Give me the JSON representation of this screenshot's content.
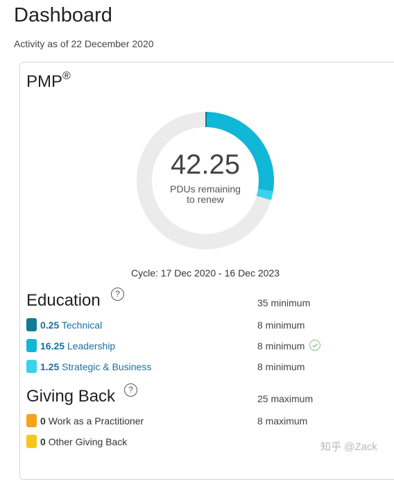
{
  "header": {
    "title": "Dashboard",
    "subtitle": "Activity as of 22 December 2020"
  },
  "cert": {
    "name": "PMP",
    "mark": "®",
    "pdus_remaining": "42.25",
    "remaining_label_line1": "PDUs remaining",
    "remaining_label_line2": "to renew",
    "cycle": "Cycle: 17 Dec 2020 - 16 Dec 2023",
    "progress": {
      "total_required": 60,
      "segments": [
        {
          "name": "Technical",
          "value": 0.25,
          "color": "#0e7c93"
        },
        {
          "name": "Leadership",
          "value": 16.25,
          "color": "#11b7d6"
        },
        {
          "name": "Strategic & Business",
          "value": 1.25,
          "color": "#3cd1ec"
        }
      ],
      "track_color": "#ebebeb"
    }
  },
  "education": {
    "title": "Education",
    "help": "?",
    "requirement": "35 minimum",
    "items": [
      {
        "value": "0.25",
        "label": "Technical",
        "requirement": "8 minimum",
        "color": "#0e7c93"
      },
      {
        "value": "16.25",
        "label": "Leadership",
        "requirement": "8 minimum",
        "color": "#11b7d6"
      },
      {
        "value": "1.25",
        "label": "Strategic & Business",
        "requirement": "8 minimum",
        "color": "#3cd1ec"
      }
    ]
  },
  "giving_back": {
    "title": "Giving Back",
    "help": "?",
    "requirement": "25 maximum",
    "items": [
      {
        "value": "0",
        "label": "Work as a Practitioner",
        "requirement": "8 maximum",
        "color": "#f5a31a"
      },
      {
        "value": "0",
        "label": "Other Giving Back",
        "requirement": "",
        "color": "#f7c617"
      }
    ]
  },
  "watermark": "知乎 @Zack"
}
